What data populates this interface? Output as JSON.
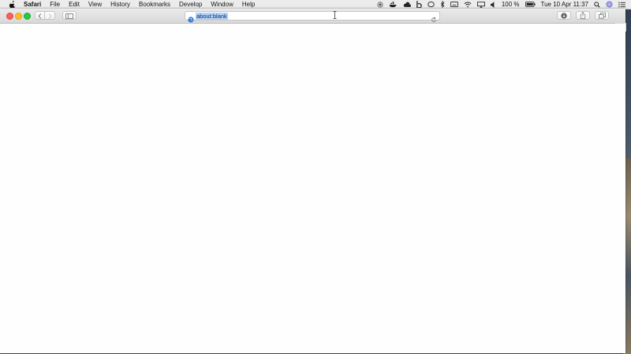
{
  "menubar": {
    "app_name": "Safari",
    "items": [
      "File",
      "Edit",
      "View",
      "History",
      "Bookmarks",
      "Develop",
      "Window",
      "Help"
    ],
    "battery": "100 %",
    "date_time": "Tue 10 Apr  11:37"
  },
  "browser": {
    "url": "about:blank"
  },
  "icons": {
    "apple": "apple-logo-icon",
    "back": "chevron-left-icon",
    "forward": "chevron-right-icon",
    "sidebar": "sidebar-icon",
    "globe": "globe-icon",
    "reload": "reload-icon",
    "download": "download-icon",
    "share": "share-icon",
    "tabs": "tabs-overview-icon",
    "new_tab": "plus-icon"
  }
}
